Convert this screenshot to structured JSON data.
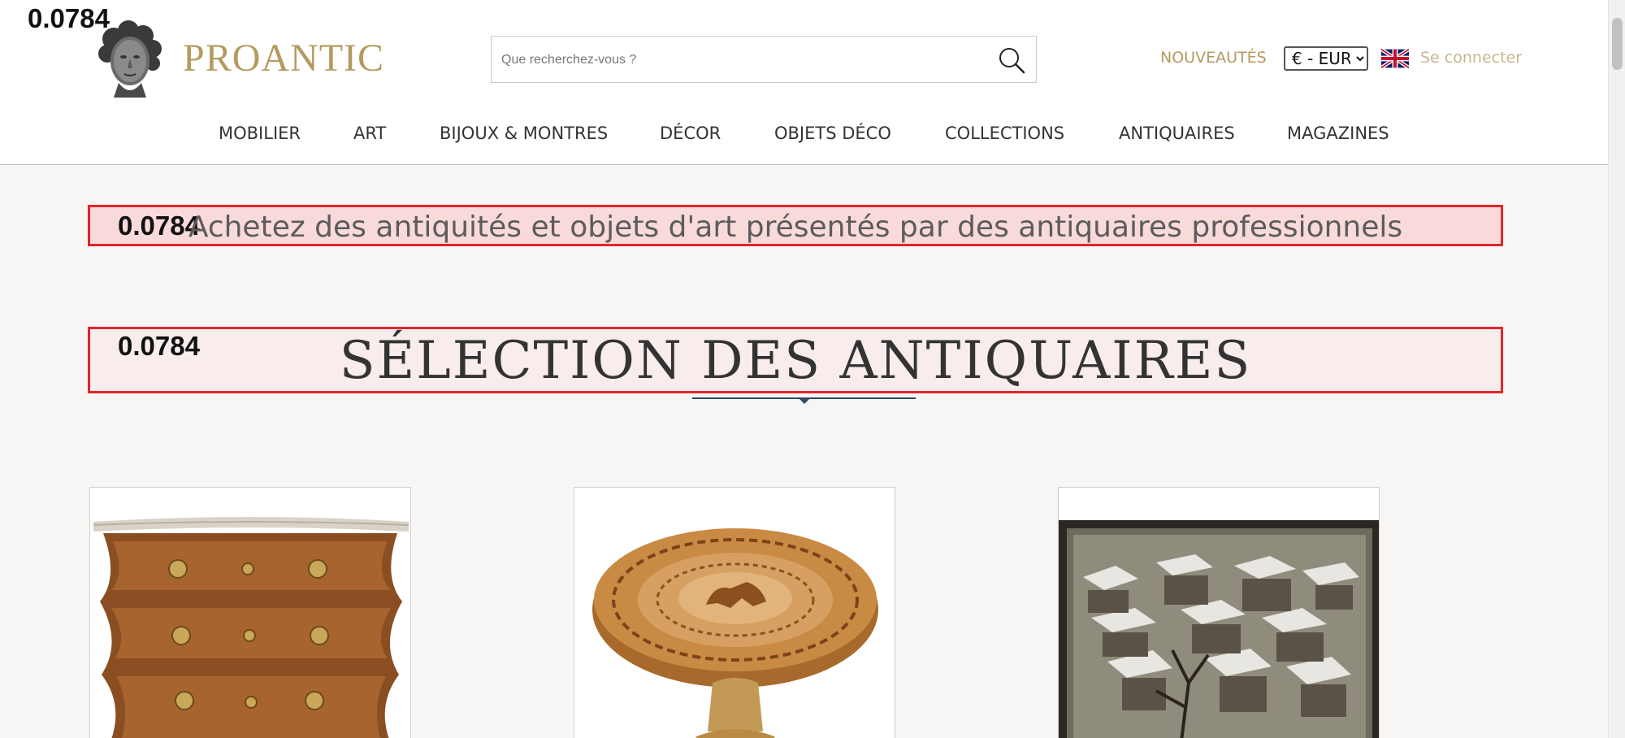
{
  "debug": {
    "score": "0.0784"
  },
  "header": {
    "logo_text": "PROANTIC",
    "search": {
      "placeholder": "Que recherchez-vous ?",
      "value": ""
    },
    "nouveautes": "NOUVEAUTÉS",
    "currency": {
      "selected": "€ - EUR"
    },
    "language_flag": "uk-flag-icon",
    "login": "Se connecter"
  },
  "nav": {
    "items": [
      {
        "label": "MOBILIER"
      },
      {
        "label": "ART"
      },
      {
        "label": "BIJOUX & MONTRES"
      },
      {
        "label": "DÉCOR"
      },
      {
        "label": "OBJETS DÉCO"
      },
      {
        "label": "COLLECTIONS"
      },
      {
        "label": "ANTIQUAIRES"
      },
      {
        "label": "MAGAZINES"
      }
    ]
  },
  "main": {
    "tagline": {
      "score": "0.0784",
      "text": "Achetez des antiquités et objets d'art présentés par des antiquaires professionnels"
    },
    "section_title": {
      "score": "0.0784",
      "text": "SÉLECTION DES ANTIQUAIRES"
    },
    "products": [
      {
        "image": "commode-image"
      },
      {
        "image": "round-table-image"
      },
      {
        "image": "painting-image"
      }
    ]
  },
  "colors": {
    "brand_gold": "#b59a60",
    "login_gold": "#c9b68e",
    "highlight_red": "#e3242b",
    "underline_navy": "#2e4a66"
  }
}
